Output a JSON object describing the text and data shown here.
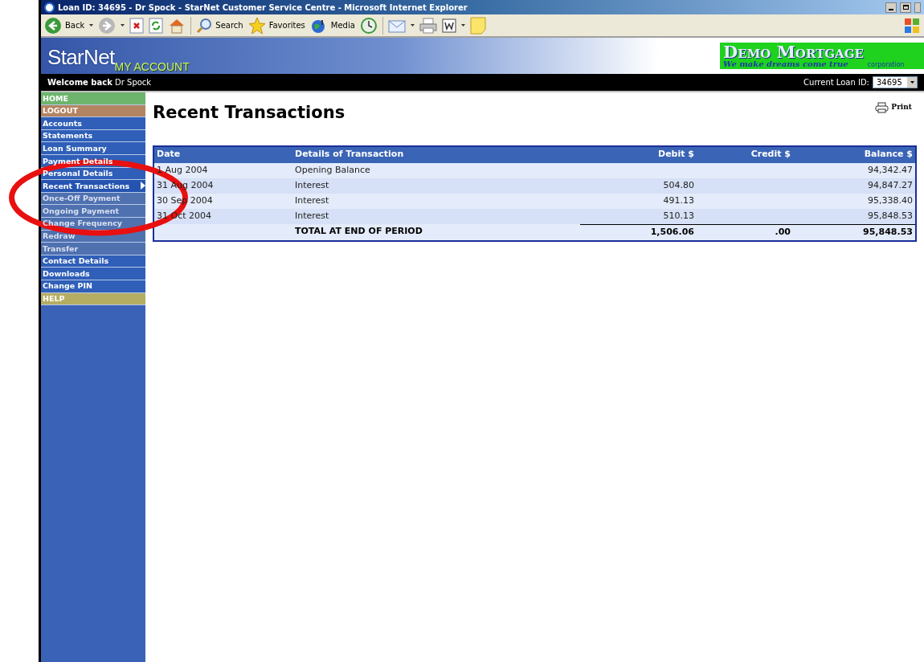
{
  "window": {
    "title": "Loan ID: 34695 - Dr Spock - StarNet Customer Service Centre - Microsoft Internet Explorer"
  },
  "toolbar": [
    {
      "kind": "back",
      "label": "Back"
    },
    {
      "kind": "forward"
    },
    {
      "kind": "stop"
    },
    {
      "kind": "refresh"
    },
    {
      "kind": "home"
    },
    {
      "kind": "search",
      "label": "Search"
    },
    {
      "kind": "favorites",
      "label": "Favorites"
    },
    {
      "kind": "media",
      "label": "Media"
    },
    {
      "kind": "history"
    },
    {
      "kind": "mail"
    },
    {
      "kind": "print"
    },
    {
      "kind": "word"
    },
    {
      "kind": "note"
    }
  ],
  "banner": {
    "logo": "StarNet",
    "subtitle": "MY ACCOUNT",
    "sponsor": "Demo Mortgage",
    "sponsor_sub": "corporation",
    "tagline": "We make dreams come true"
  },
  "welcome": {
    "greeting": "Welcome back",
    "name": "Dr Spock",
    "loan_label": "Current Loan ID:",
    "loan_id": "34695"
  },
  "sidebar": {
    "items": [
      {
        "label": "HOME",
        "kind": "home",
        "selected": false
      },
      {
        "label": "LOGOUT",
        "kind": "logout",
        "selected": false
      },
      {
        "label": "Accounts",
        "kind": "link",
        "selected": false,
        "disabled": false
      },
      {
        "label": "Statements",
        "kind": "link",
        "selected": false,
        "disabled": false
      },
      {
        "label": "Loan Summary",
        "kind": "link",
        "selected": false,
        "disabled": false
      },
      {
        "label": "Payment Details",
        "kind": "link",
        "selected": false,
        "disabled": false
      },
      {
        "label": "Personal Details",
        "kind": "link",
        "selected": false,
        "disabled": false
      },
      {
        "label": "Recent Transactions",
        "kind": "link",
        "selected": true,
        "disabled": false
      },
      {
        "label": "Once-Off Payment",
        "kind": "link",
        "selected": false,
        "disabled": true
      },
      {
        "label": "Ongoing Payment",
        "kind": "link",
        "selected": false,
        "disabled": true
      },
      {
        "label": "Change Frequency",
        "kind": "link",
        "selected": false,
        "disabled": true
      },
      {
        "label": "Redraw",
        "kind": "link",
        "selected": false,
        "disabled": true
      },
      {
        "label": "Transfer",
        "kind": "link",
        "selected": false,
        "disabled": true
      },
      {
        "label": "Contact Details",
        "kind": "link",
        "selected": false,
        "disabled": false
      },
      {
        "label": "Downloads",
        "kind": "link",
        "selected": false,
        "disabled": false
      },
      {
        "label": "Change PIN",
        "kind": "link",
        "selected": false,
        "disabled": false
      },
      {
        "label": "HELP",
        "kind": "help",
        "selected": false
      }
    ]
  },
  "page": {
    "heading": "Recent Transactions",
    "print": "Print"
  },
  "table": {
    "columns": [
      "Date",
      "Details of Transaction",
      "Debit $",
      "Credit $",
      "Balance $"
    ],
    "rows": [
      [
        "1 Aug 2004",
        "Opening Balance",
        "",
        "",
        "94,342.47"
      ],
      [
        "31 Aug 2004",
        "Interest",
        "504.80",
        "",
        "94,847.27"
      ],
      [
        "30 Sep 2004",
        "Interest",
        "491.13",
        "",
        "95,338.40"
      ],
      [
        "31 Oct 2004",
        "Interest",
        "510.13",
        "",
        "95,848.53"
      ]
    ],
    "total": {
      "label": "TOTAL AT END OF PERIOD",
      "debit": "1,506.06",
      "credit": ".00",
      "balance": "95,848.53"
    }
  }
}
